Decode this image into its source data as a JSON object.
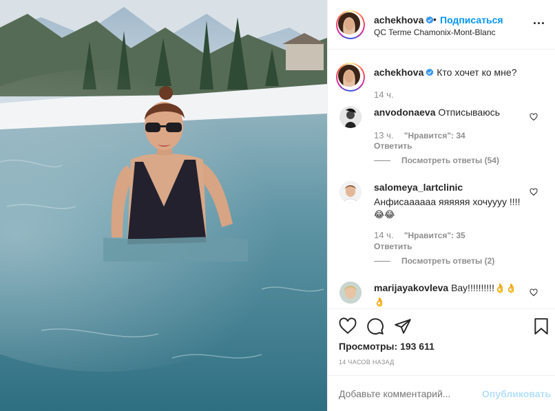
{
  "post": {
    "username": "achekhova",
    "follow_label": "Подписаться",
    "dot": "•",
    "location": "QC Terme Chamonix-Mont-Blanc",
    "more_icon": "more-horizontal-icon",
    "caption": "Кто хочет ко мне?",
    "caption_time": "14 ч."
  },
  "comments": [
    {
      "username": "anvodonaeva",
      "text": "Отписываюсь",
      "time": "13 ч.",
      "likes": "\"Нравится\": 34",
      "reply_label": "Ответить",
      "view_replies": "Посмотреть ответы (54)"
    },
    {
      "username": "salomeya_lartclinic",
      "text": "Анфисаааааа яяяяяя хочуууу !!!!",
      "emojis": "😂😂",
      "time": "14 ч.",
      "likes": "\"Нравится\": 35",
      "reply_label": "Ответить",
      "view_replies": "Посмотреть ответы (2)"
    },
    {
      "username": "marijayakovleva",
      "text": "Вау!!!!!!!!!!",
      "emojis": "👌👌👌",
      "emojis2": "🙏🙏🤗"
    }
  ],
  "actions": {
    "views_label": "Просмотры:",
    "views_count": "193 611",
    "time_ago": "14 ЧАСОВ НАЗАД"
  },
  "add_comment": {
    "placeholder": "Добавьте комментарий...",
    "publish_label": "Опубликовать"
  },
  "colors": {
    "accent": "#0095f6",
    "publish_disabled": "#b2dffc",
    "verified": "#3897f0"
  }
}
